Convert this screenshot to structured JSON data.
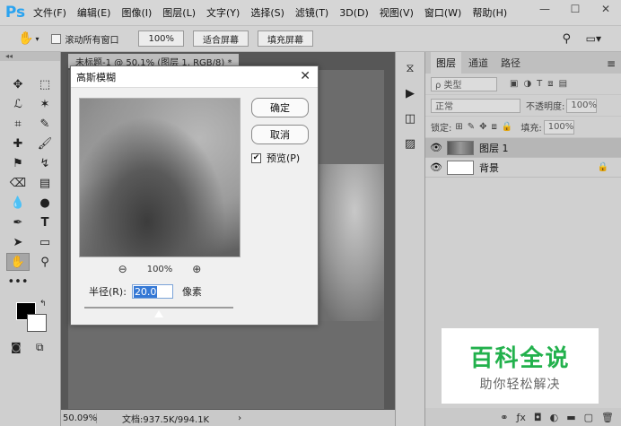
{
  "app": {
    "logo": "Ps"
  },
  "menu": [
    "文件(F)",
    "编辑(E)",
    "图像(I)",
    "图层(L)",
    "文字(Y)",
    "选择(S)",
    "滤镜(T)",
    "3D(D)",
    "视图(V)",
    "窗口(W)",
    "帮助(H)"
  ],
  "options": {
    "scroll_all_label": "滚动所有窗口",
    "zoom_value": "100%",
    "fit_screen": "适合屏幕",
    "fill_screen": "填充屏幕"
  },
  "document": {
    "tab_title": "未标题-1 @ 50.1% (图层 1, RGB/8) *",
    "zoom_status": "50.09%",
    "doc_status": "文档:937.5K/994.1K"
  },
  "dialog": {
    "title": "高斯模糊",
    "ok_label": "确定",
    "cancel_label": "取消",
    "preview_label": "预览(P)",
    "preview_checked": "✔",
    "zoom_value": "100%",
    "radius_label": "半径(R):",
    "radius_value": "20.0",
    "unit_label": "像素",
    "slider_position": 0.5
  },
  "layers_panel": {
    "tabs": [
      "图层",
      "通道",
      "路径"
    ],
    "filter_kind": "ρ 类型",
    "blend_mode": "正常",
    "opacity_label": "不透明度:",
    "opacity_value": "100%",
    "lock_label": "锁定:",
    "fill_label": "填充:",
    "fill_value": "100%",
    "layers": [
      {
        "name": "图层 1"
      },
      {
        "name": "背景"
      }
    ]
  },
  "watermark": {
    "main": "百科全说",
    "sub": "助你轻松解决"
  }
}
